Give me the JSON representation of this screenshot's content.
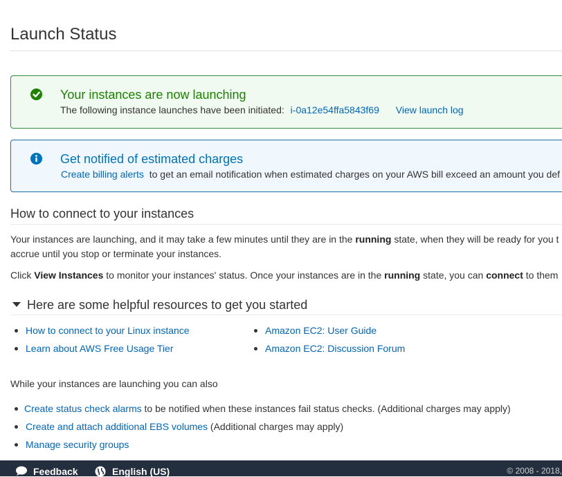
{
  "page": {
    "title": "Launch Status"
  },
  "success_alert": {
    "title": "Your instances are now launching",
    "text": "The following instance launches have been initiated:",
    "instance_id": "i-0a12e54ffa5843f69",
    "view_log_label": "View launch log",
    "icon": "check-circle-icon",
    "color": "#1d8102"
  },
  "info_alert": {
    "title": "Get notified of estimated charges",
    "link_label": "Create billing alerts",
    "text": "to get an email notification when estimated charges on your AWS bill exceed an amount you def",
    "icon": "info-circle-icon",
    "color": "#0073bb"
  },
  "connect": {
    "heading": "How to connect to your instances",
    "p1_a": "Your instances are launching, and it may take a few minutes until they are in the ",
    "p1_b": "running",
    "p1_c": " state, when they will be ready for you t",
    "p1_line2": "accrue until you stop or terminate your instances.",
    "p2_a": "Click ",
    "p2_b": "View Instances",
    "p2_c": " to monitor your instances' status. Once your instances are in the ",
    "p2_d": "running",
    "p2_e": " state, you can ",
    "p2_f": "connect",
    "p2_g": " to them"
  },
  "resources": {
    "heading": "Here are some helpful resources to get you started",
    "left": [
      {
        "label": "How to connect to your Linux instance"
      },
      {
        "label": "Learn about AWS Free Usage Tier"
      }
    ],
    "right": [
      {
        "label": "Amazon EC2: User Guide"
      },
      {
        "label": "Amazon EC2: Discussion Forum"
      }
    ]
  },
  "also": {
    "intro": "While your instances are launching you can also",
    "items": [
      {
        "link": "Create status check alarms",
        "text": " to be notified when these instances fail status checks. (Additional charges may apply)"
      },
      {
        "link": "Create and attach additional EBS volumes",
        "text": " (Additional charges may apply)"
      },
      {
        "link": "Manage security groups",
        "text": ""
      }
    ]
  },
  "footer": {
    "feedback": "Feedback",
    "language": "English (US)",
    "copyright": "© 2008 - 2018,",
    "bg_color": "#232f3e"
  }
}
